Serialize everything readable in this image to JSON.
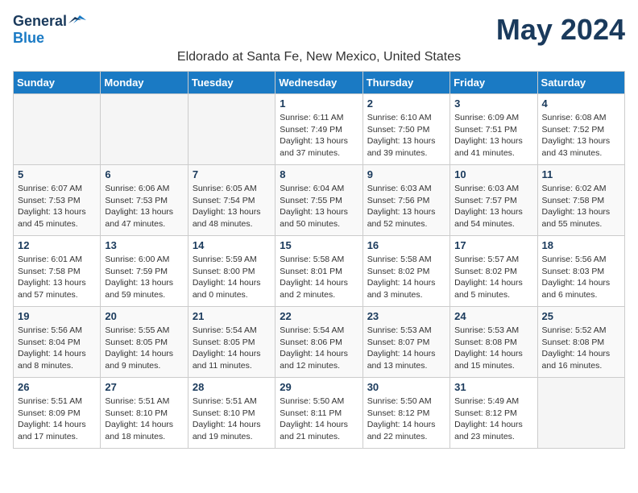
{
  "header": {
    "logo_general": "General",
    "logo_blue": "Blue",
    "month_title": "May 2024",
    "location": "Eldorado at Santa Fe, New Mexico, United States"
  },
  "weekdays": [
    "Sunday",
    "Monday",
    "Tuesday",
    "Wednesday",
    "Thursday",
    "Friday",
    "Saturday"
  ],
  "weeks": [
    [
      {
        "day": "",
        "info": ""
      },
      {
        "day": "",
        "info": ""
      },
      {
        "day": "",
        "info": ""
      },
      {
        "day": "1",
        "info": "Sunrise: 6:11 AM\nSunset: 7:49 PM\nDaylight: 13 hours and 37 minutes."
      },
      {
        "day": "2",
        "info": "Sunrise: 6:10 AM\nSunset: 7:50 PM\nDaylight: 13 hours and 39 minutes."
      },
      {
        "day": "3",
        "info": "Sunrise: 6:09 AM\nSunset: 7:51 PM\nDaylight: 13 hours and 41 minutes."
      },
      {
        "day": "4",
        "info": "Sunrise: 6:08 AM\nSunset: 7:52 PM\nDaylight: 13 hours and 43 minutes."
      }
    ],
    [
      {
        "day": "5",
        "info": "Sunrise: 6:07 AM\nSunset: 7:53 PM\nDaylight: 13 hours and 45 minutes."
      },
      {
        "day": "6",
        "info": "Sunrise: 6:06 AM\nSunset: 7:53 PM\nDaylight: 13 hours and 47 minutes."
      },
      {
        "day": "7",
        "info": "Sunrise: 6:05 AM\nSunset: 7:54 PM\nDaylight: 13 hours and 48 minutes."
      },
      {
        "day": "8",
        "info": "Sunrise: 6:04 AM\nSunset: 7:55 PM\nDaylight: 13 hours and 50 minutes."
      },
      {
        "day": "9",
        "info": "Sunrise: 6:03 AM\nSunset: 7:56 PM\nDaylight: 13 hours and 52 minutes."
      },
      {
        "day": "10",
        "info": "Sunrise: 6:03 AM\nSunset: 7:57 PM\nDaylight: 13 hours and 54 minutes."
      },
      {
        "day": "11",
        "info": "Sunrise: 6:02 AM\nSunset: 7:58 PM\nDaylight: 13 hours and 55 minutes."
      }
    ],
    [
      {
        "day": "12",
        "info": "Sunrise: 6:01 AM\nSunset: 7:58 PM\nDaylight: 13 hours and 57 minutes."
      },
      {
        "day": "13",
        "info": "Sunrise: 6:00 AM\nSunset: 7:59 PM\nDaylight: 13 hours and 59 minutes."
      },
      {
        "day": "14",
        "info": "Sunrise: 5:59 AM\nSunset: 8:00 PM\nDaylight: 14 hours and 0 minutes."
      },
      {
        "day": "15",
        "info": "Sunrise: 5:58 AM\nSunset: 8:01 PM\nDaylight: 14 hours and 2 minutes."
      },
      {
        "day": "16",
        "info": "Sunrise: 5:58 AM\nSunset: 8:02 PM\nDaylight: 14 hours and 3 minutes."
      },
      {
        "day": "17",
        "info": "Sunrise: 5:57 AM\nSunset: 8:02 PM\nDaylight: 14 hours and 5 minutes."
      },
      {
        "day": "18",
        "info": "Sunrise: 5:56 AM\nSunset: 8:03 PM\nDaylight: 14 hours and 6 minutes."
      }
    ],
    [
      {
        "day": "19",
        "info": "Sunrise: 5:56 AM\nSunset: 8:04 PM\nDaylight: 14 hours and 8 minutes."
      },
      {
        "day": "20",
        "info": "Sunrise: 5:55 AM\nSunset: 8:05 PM\nDaylight: 14 hours and 9 minutes."
      },
      {
        "day": "21",
        "info": "Sunrise: 5:54 AM\nSunset: 8:05 PM\nDaylight: 14 hours and 11 minutes."
      },
      {
        "day": "22",
        "info": "Sunrise: 5:54 AM\nSunset: 8:06 PM\nDaylight: 14 hours and 12 minutes."
      },
      {
        "day": "23",
        "info": "Sunrise: 5:53 AM\nSunset: 8:07 PM\nDaylight: 14 hours and 13 minutes."
      },
      {
        "day": "24",
        "info": "Sunrise: 5:53 AM\nSunset: 8:08 PM\nDaylight: 14 hours and 15 minutes."
      },
      {
        "day": "25",
        "info": "Sunrise: 5:52 AM\nSunset: 8:08 PM\nDaylight: 14 hours and 16 minutes."
      }
    ],
    [
      {
        "day": "26",
        "info": "Sunrise: 5:51 AM\nSunset: 8:09 PM\nDaylight: 14 hours and 17 minutes."
      },
      {
        "day": "27",
        "info": "Sunrise: 5:51 AM\nSunset: 8:10 PM\nDaylight: 14 hours and 18 minutes."
      },
      {
        "day": "28",
        "info": "Sunrise: 5:51 AM\nSunset: 8:10 PM\nDaylight: 14 hours and 19 minutes."
      },
      {
        "day": "29",
        "info": "Sunrise: 5:50 AM\nSunset: 8:11 PM\nDaylight: 14 hours and 21 minutes."
      },
      {
        "day": "30",
        "info": "Sunrise: 5:50 AM\nSunset: 8:12 PM\nDaylight: 14 hours and 22 minutes."
      },
      {
        "day": "31",
        "info": "Sunrise: 5:49 AM\nSunset: 8:12 PM\nDaylight: 14 hours and 23 minutes."
      },
      {
        "day": "",
        "info": ""
      }
    ]
  ]
}
